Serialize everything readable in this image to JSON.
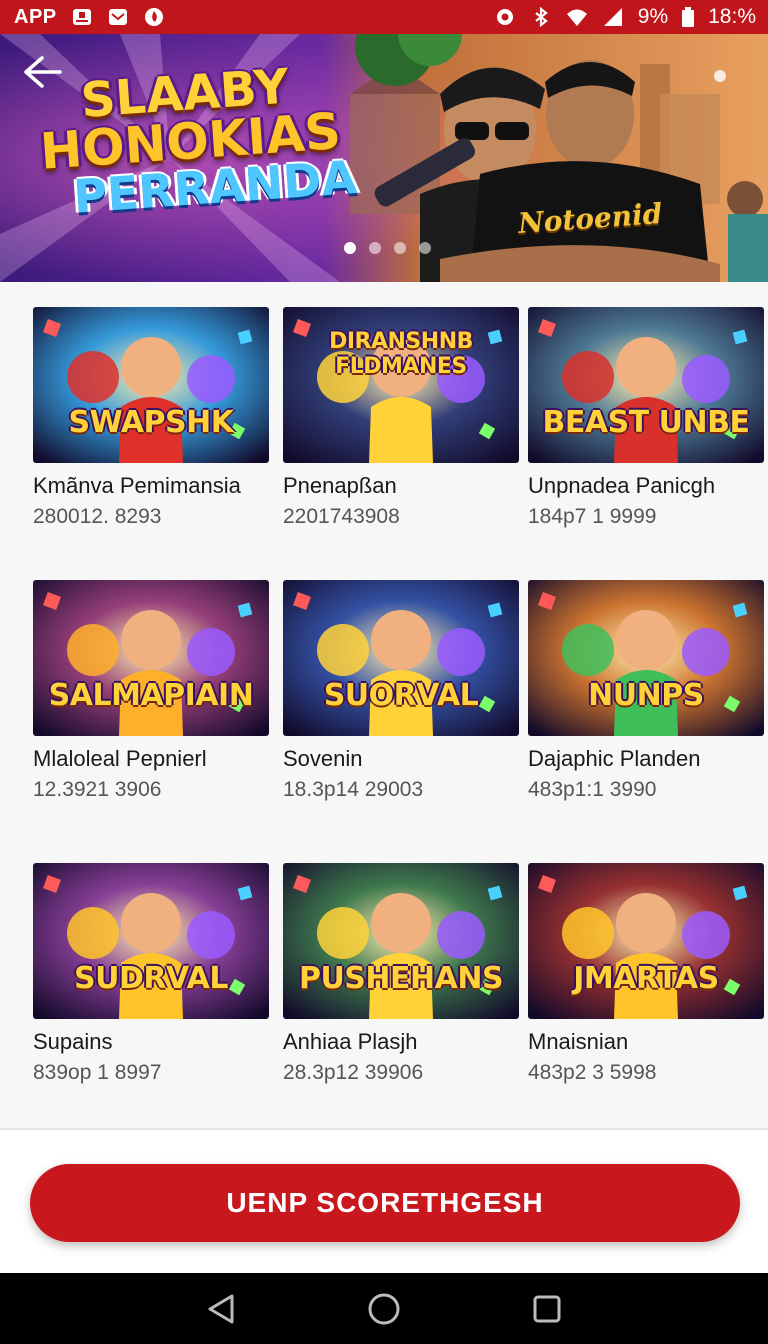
{
  "status_bar": {
    "app_label": "APP",
    "battery": "9%",
    "time": "18:%",
    "icons": [
      "notification-icon",
      "mail-icon",
      "flame-icon",
      "settings-icon",
      "bluetooth-icon",
      "wifi-icon",
      "signal-icon",
      "battery-icon"
    ]
  },
  "hero": {
    "title_lines": [
      "SLAABY",
      "HONOKIAS",
      "PERRANDA"
    ],
    "shirt_text": "Notoenid",
    "carousel_dots": 4,
    "active_dot": 0,
    "back_icon": "back-arrow-icon"
  },
  "games": [
    {
      "title": "Kmãnva Pemimansia",
      "subtitle": "280012. 8293",
      "thumb_text": "SWAPSHK",
      "bg": "#1f8fd6",
      "accent": "#e0302a"
    },
    {
      "title": "Pnenapßan",
      "subtitle": "2201743908",
      "thumb_text": "DIRANSHNB FLDMANES",
      "bg": "#1b2a6a",
      "accent": "#ffd23a"
    },
    {
      "title": "Unpnadea Panicgh",
      "subtitle": "184p7 1 9999",
      "thumb_text": "BEAST UNBE",
      "bg": "#3a6a8a",
      "accent": "#d8302a"
    },
    {
      "title": "Mlaloleal Pepnierl",
      "subtitle": "12.3921 3906",
      "thumb_text": "SALMAPIAIN",
      "bg": "#8a2a6a",
      "accent": "#ffb02a"
    },
    {
      "title": "Sovenin",
      "subtitle": "18.3p14 29003",
      "thumb_text": "SUORVAL",
      "bg": "#1e3f9a",
      "accent": "#ffd23a"
    },
    {
      "title": "Dajaphic Planden",
      "subtitle": "483p1:1 3990",
      "thumb_text": "NUNPS",
      "bg": "#c8651a",
      "accent": "#3fbf5a"
    },
    {
      "title": "Supains",
      "subtitle": "839op 1 8997",
      "thumb_text": "SUDRVAL",
      "bg": "#7a2a8a",
      "accent": "#ffc42a"
    },
    {
      "title": "Anhiaa Plasjh",
      "subtitle": "28.3p12 39906",
      "thumb_text": "PUSHEHANS",
      "bg": "#2a6a3a",
      "accent": "#ffd23a"
    },
    {
      "title": "Mnaisnian",
      "subtitle": "483p2 3 5998",
      "thumb_text": "JMARTAS",
      "bg": "#8a1a1a",
      "accent": "#ffc42a"
    }
  ],
  "cta": {
    "label": "UENP SCORETHGESH"
  },
  "nav": {
    "back": "back-triangle-icon",
    "home": "home-circle-icon",
    "recents": "recents-square-icon"
  },
  "colors": {
    "brand_red": "#c0151b",
    "cta_red": "#c8181e",
    "background": "#f7f7f7"
  }
}
